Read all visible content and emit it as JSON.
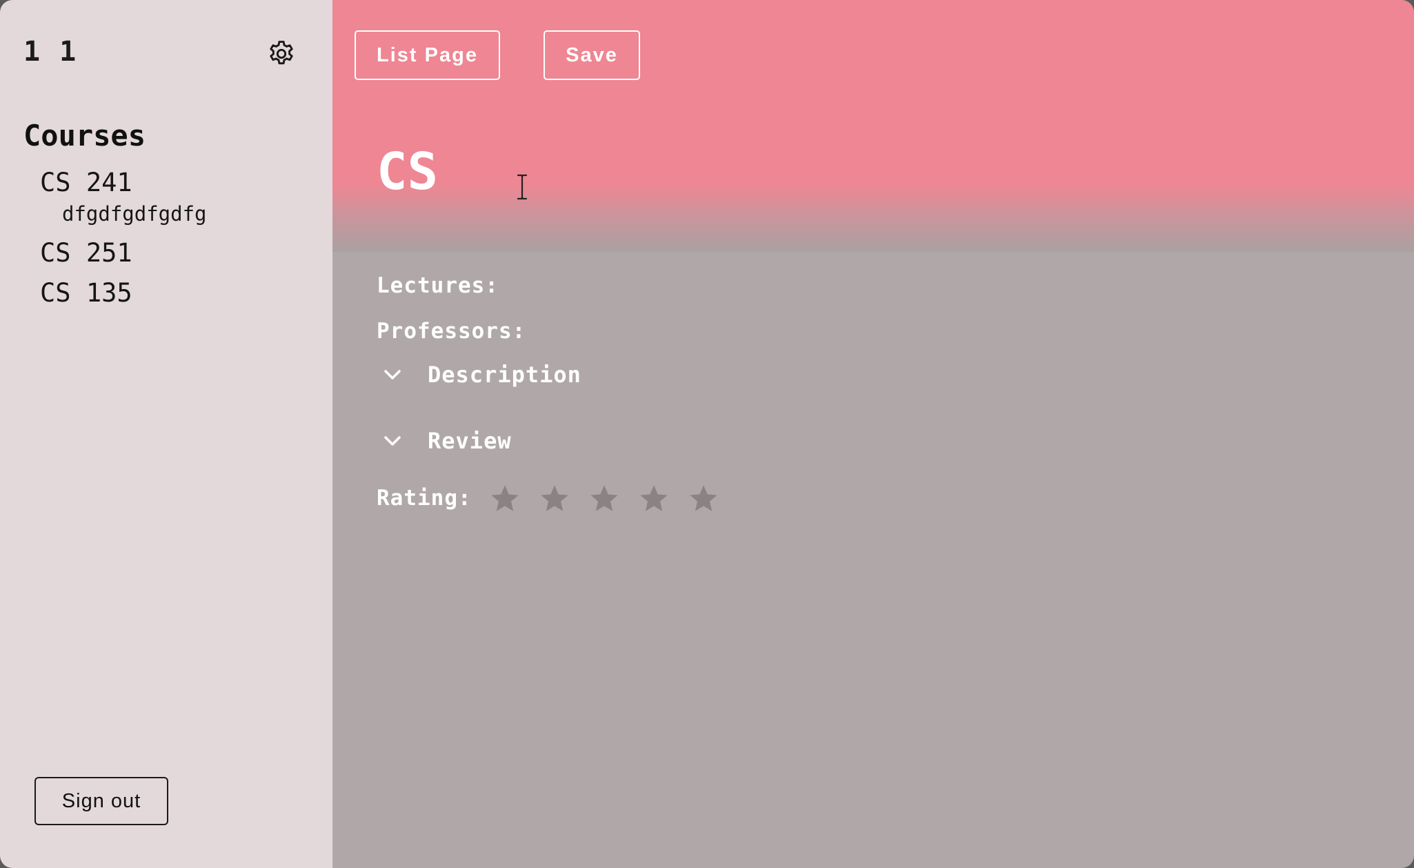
{
  "sidebar": {
    "user_name": "1 1",
    "settings_icon": "gear-icon",
    "courses_heading": "Courses",
    "courses": [
      {
        "code": "CS 241",
        "subtitle": "dfgdfgdfgdfg"
      },
      {
        "code": "CS 251"
      },
      {
        "code": "CS 135"
      }
    ],
    "sign_out_label": "Sign out"
  },
  "header": {
    "list_page_label": "List Page",
    "save_label": "Save",
    "course_title": "CS"
  },
  "details": {
    "lectures_label": "Lectures:",
    "professors_label": "Professors:",
    "description_label": "Description",
    "review_label": "Review",
    "rating_label": "Rating:",
    "rating_value": 0,
    "rating_max": 5
  },
  "colors": {
    "hero": "#ef8693",
    "sidebar": "#e4d9da",
    "main": "#b0a8a8",
    "star": "#8a8384"
  }
}
